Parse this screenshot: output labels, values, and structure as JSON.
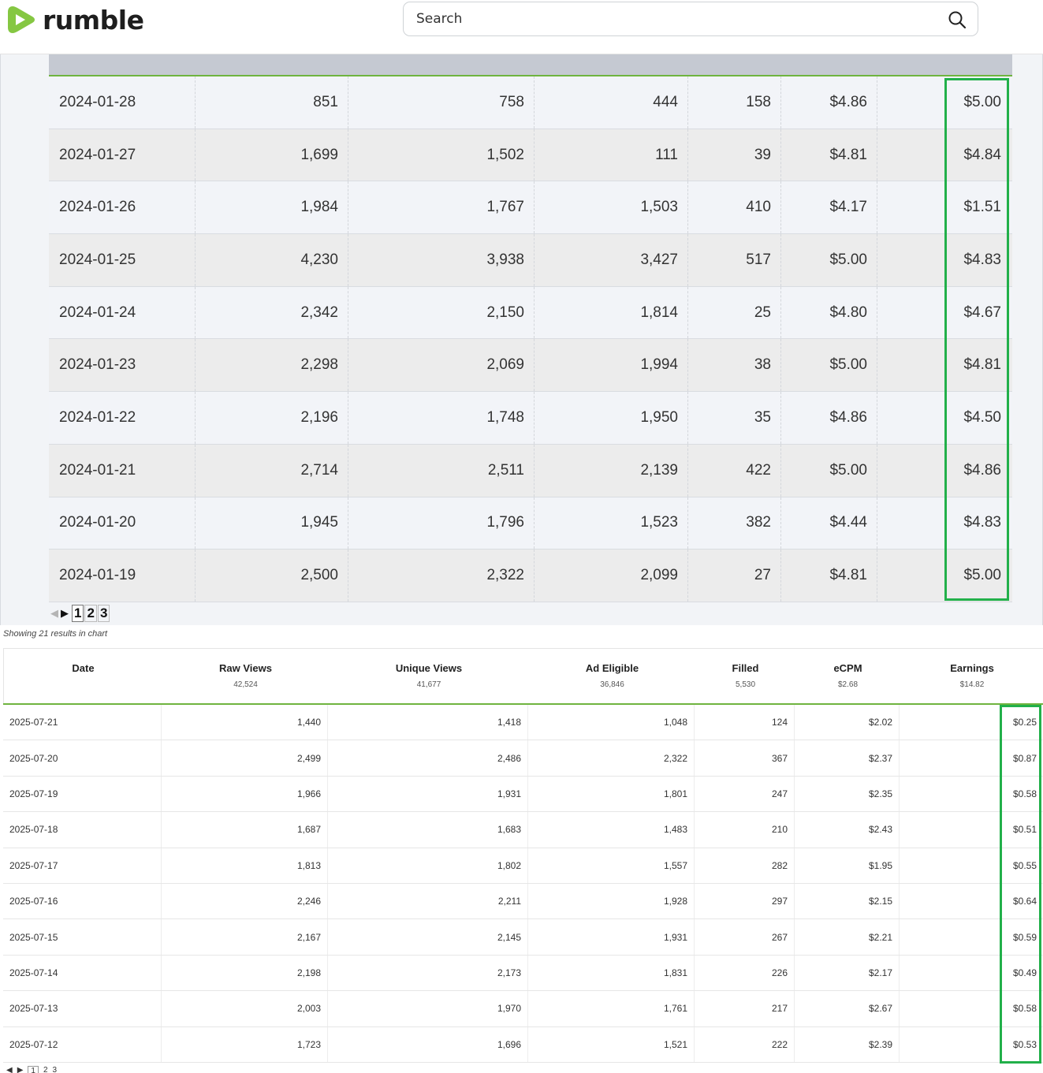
{
  "header": {
    "logo_text": "rumble",
    "search_placeholder": "Search",
    "brand_color": "#85c742"
  },
  "top_table": {
    "rows": [
      {
        "date": "2024-01-28",
        "raw_views": "851",
        "unique_views": "758",
        "ad_eligible": "444",
        "filled": "158",
        "ecpm": "$4.86",
        "earnings": "$5.00"
      },
      {
        "date": "2024-01-27",
        "raw_views": "1,699",
        "unique_views": "1,502",
        "ad_eligible": "111",
        "filled": "39",
        "ecpm": "$4.81",
        "earnings": "$4.84"
      },
      {
        "date": "2024-01-26",
        "raw_views": "1,984",
        "unique_views": "1,767",
        "ad_eligible": "1,503",
        "filled": "410",
        "ecpm": "$4.17",
        "earnings": "$1.51"
      },
      {
        "date": "2024-01-25",
        "raw_views": "4,230",
        "unique_views": "3,938",
        "ad_eligible": "3,427",
        "filled": "517",
        "ecpm": "$5.00",
        "earnings": "$4.83"
      },
      {
        "date": "2024-01-24",
        "raw_views": "2,342",
        "unique_views": "2,150",
        "ad_eligible": "1,814",
        "filled": "25",
        "ecpm": "$4.80",
        "earnings": "$4.67"
      },
      {
        "date": "2024-01-23",
        "raw_views": "2,298",
        "unique_views": "2,069",
        "ad_eligible": "1,994",
        "filled": "38",
        "ecpm": "$5.00",
        "earnings": "$4.81"
      },
      {
        "date": "2024-01-22",
        "raw_views": "2,196",
        "unique_views": "1,748",
        "ad_eligible": "1,950",
        "filled": "35",
        "ecpm": "$4.86",
        "earnings": "$4.50"
      },
      {
        "date": "2024-01-21",
        "raw_views": "2,714",
        "unique_views": "2,511",
        "ad_eligible": "2,139",
        "filled": "422",
        "ecpm": "$5.00",
        "earnings": "$4.86"
      },
      {
        "date": "2024-01-20",
        "raw_views": "1,945",
        "unique_views": "1,796",
        "ad_eligible": "1,523",
        "filled": "382",
        "ecpm": "$4.44",
        "earnings": "$4.83"
      },
      {
        "date": "2024-01-19",
        "raw_views": "2,500",
        "unique_views": "2,322",
        "ad_eligible": "2,099",
        "filled": "27",
        "ecpm": "$4.81",
        "earnings": "$5.00"
      }
    ],
    "pager": {
      "prev": "◀",
      "next": "▶",
      "pages": [
        "1",
        "2",
        "3"
      ]
    }
  },
  "bottom_table": {
    "showing_text": "Showing 21 results in chart",
    "columns": [
      {
        "title": "Date",
        "sub": ""
      },
      {
        "title": "Raw Views",
        "sub": "42,524"
      },
      {
        "title": "Unique Views",
        "sub": "41,677"
      },
      {
        "title": "Ad Eligible",
        "sub": "36,846"
      },
      {
        "title": "Filled",
        "sub": "5,530"
      },
      {
        "title": "eCPM",
        "sub": "$2.68"
      },
      {
        "title": "Earnings",
        "sub": "$14.82"
      }
    ],
    "rows": [
      {
        "date": "2025-07-21",
        "raw_views": "1,440",
        "unique_views": "1,418",
        "ad_eligible": "1,048",
        "filled": "124",
        "ecpm": "$2.02",
        "earnings": "$0.25"
      },
      {
        "date": "2025-07-20",
        "raw_views": "2,499",
        "unique_views": "2,486",
        "ad_eligible": "2,322",
        "filled": "367",
        "ecpm": "$2.37",
        "earnings": "$0.87"
      },
      {
        "date": "2025-07-19",
        "raw_views": "1,966",
        "unique_views": "1,931",
        "ad_eligible": "1,801",
        "filled": "247",
        "ecpm": "$2.35",
        "earnings": "$0.58"
      },
      {
        "date": "2025-07-18",
        "raw_views": "1,687",
        "unique_views": "1,683",
        "ad_eligible": "1,483",
        "filled": "210",
        "ecpm": "$2.43",
        "earnings": "$0.51"
      },
      {
        "date": "2025-07-17",
        "raw_views": "1,813",
        "unique_views": "1,802",
        "ad_eligible": "1,557",
        "filled": "282",
        "ecpm": "$1.95",
        "earnings": "$0.55"
      },
      {
        "date": "2025-07-16",
        "raw_views": "2,246",
        "unique_views": "2,211",
        "ad_eligible": "1,928",
        "filled": "297",
        "ecpm": "$2.15",
        "earnings": "$0.64"
      },
      {
        "date": "2025-07-15",
        "raw_views": "2,167",
        "unique_views": "2,145",
        "ad_eligible": "1,931",
        "filled": "267",
        "ecpm": "$2.21",
        "earnings": "$0.59"
      },
      {
        "date": "2025-07-14",
        "raw_views": "2,198",
        "unique_views": "2,173",
        "ad_eligible": "1,831",
        "filled": "226",
        "ecpm": "$2.17",
        "earnings": "$0.49"
      },
      {
        "date": "2025-07-13",
        "raw_views": "2,003",
        "unique_views": "1,970",
        "ad_eligible": "1,761",
        "filled": "217",
        "ecpm": "$2.67",
        "earnings": "$0.58"
      },
      {
        "date": "2025-07-12",
        "raw_views": "1,723",
        "unique_views": "1,696",
        "ad_eligible": "1,521",
        "filled": "222",
        "ecpm": "$2.39",
        "earnings": "$0.53"
      }
    ],
    "pager": {
      "prev": "◀",
      "next": "▶",
      "pages": [
        "1",
        "2",
        "3"
      ]
    }
  },
  "highlight_color": "#22b04a"
}
